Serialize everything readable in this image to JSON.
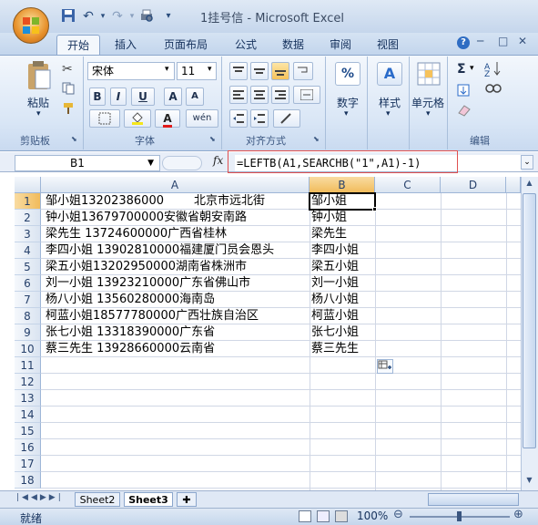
{
  "window": {
    "title": "1挂号信 - Microsoft Excel",
    "minimize": "─",
    "maximize": "□",
    "close": "✕"
  },
  "qat": {
    "save_icon": "save-icon",
    "undo_icon": "undo-icon",
    "redo_icon": "redo-icon",
    "print_icon": "print-preview-icon"
  },
  "tabs": [
    "开始",
    "插入",
    "页面布局",
    "公式",
    "数据",
    "审阅",
    "视图"
  ],
  "ribbon": {
    "clipboard": {
      "paste": "粘贴",
      "label": "剪贴板"
    },
    "font": {
      "name": "宋体",
      "size": "11",
      "bold": "B",
      "italic": "I",
      "underline": "U",
      "grow": "A",
      "shrink": "A",
      "color_a": "A",
      "wen": "wén",
      "label": "字体"
    },
    "align": {
      "label": "对齐方式"
    },
    "number": {
      "button": "数字",
      "symbol": "%"
    },
    "style": {
      "button": "样式",
      "symbol": "A"
    },
    "cells": {
      "button": "单元格"
    },
    "edit": {
      "label": "编辑",
      "sigma": "Σ"
    }
  },
  "formula_bar": {
    "cell_ref": "B1",
    "fx": "fx",
    "formula": "=LEFTB(A1,SEARCHB(\"1\",A1)-1)"
  },
  "columns": [
    "A",
    "B",
    "C",
    "D"
  ],
  "rows": [
    "1",
    "2",
    "3",
    "4",
    "5",
    "6",
    "7",
    "8",
    "9",
    "10",
    "11",
    "12",
    "13",
    "14",
    "15",
    "16",
    "17",
    "18"
  ],
  "cells": {
    "A": [
      "邹小姐13202386000        北京市远北街",
      "钟小姐13679700000安徽省朝安南路",
      "梁先生 13724600000广西省桂林",
      "李四小姐 13902810000福建厦门员会恩头",
      "梁五小姐13202950000湖南省株洲市",
      "刘一小姐 13923210000广东省佛山市",
      "杨八小姐 13560280000海南岛",
      "柯蓝小姐18577780000广西壮族自治区",
      "张七小姐 13318390000广东省",
      "蔡三先生 13928660000云南省"
    ],
    "B": [
      "邹小姐",
      "钟小姐",
      "梁先生",
      "李四小姐",
      "梁五小姐",
      "刘一小姐",
      "杨八小姐",
      "柯蓝小姐",
      "张七小姐",
      "蔡三先生"
    ]
  },
  "sheets": [
    "Sheet2",
    "Sheet3"
  ],
  "status": {
    "ready": "就绪",
    "zoom": "100%"
  },
  "colors": {
    "accent": "#15315c",
    "selection": "#f1bb5b"
  }
}
